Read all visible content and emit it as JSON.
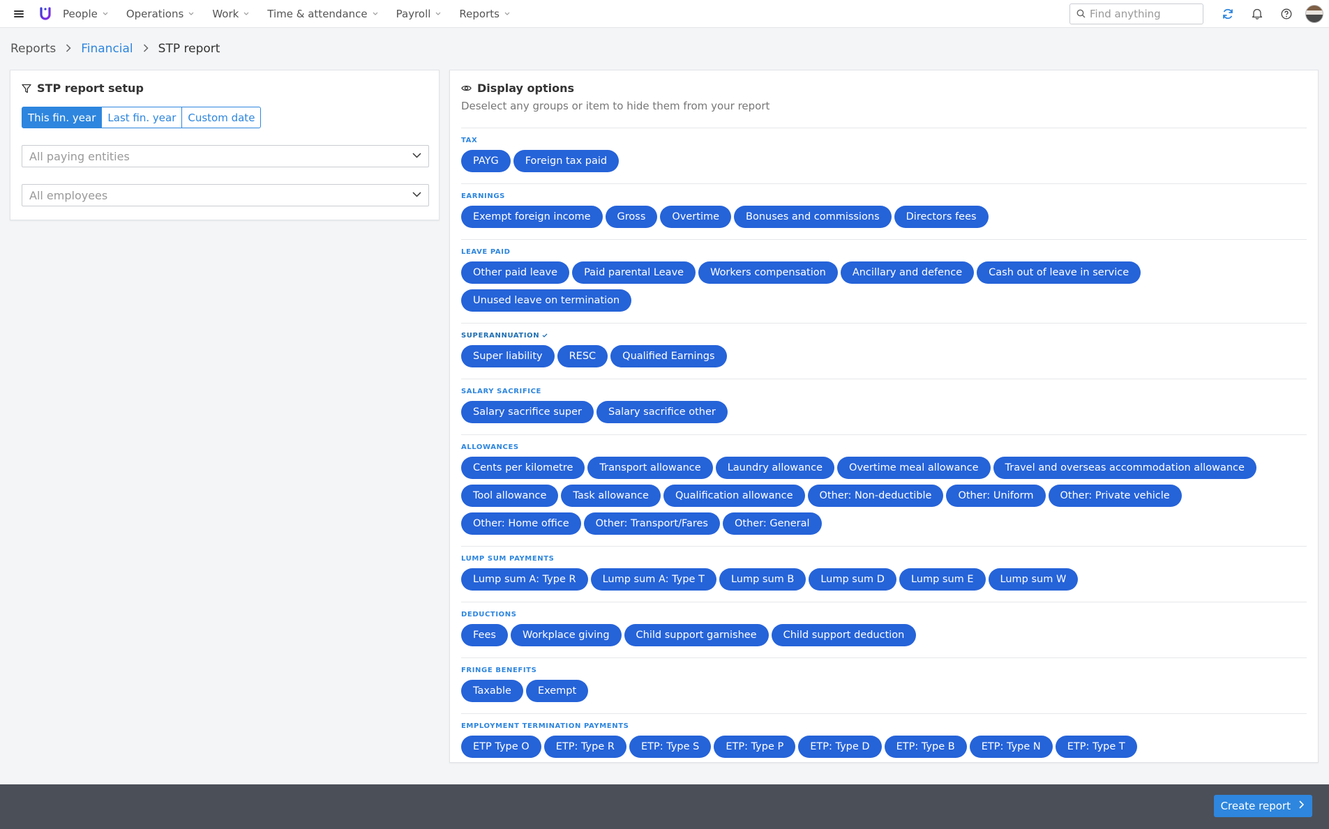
{
  "nav": {
    "items": [
      {
        "label": "People"
      },
      {
        "label": "Operations"
      },
      {
        "label": "Work"
      },
      {
        "label": "Time & attendance"
      },
      {
        "label": "Payroll"
      },
      {
        "label": "Reports"
      }
    ],
    "search_placeholder": "Find anything",
    "icons": [
      "menu-icon",
      "logo-u",
      "search-icon",
      "refresh-icon",
      "bell-icon",
      "help-icon",
      "avatar"
    ]
  },
  "breadcrumb": {
    "root": "Reports",
    "parent": "Financial",
    "current": "STP report"
  },
  "setup": {
    "title": "STP report setup",
    "periods": [
      "This fin. year",
      "Last fin. year",
      "Custom date"
    ],
    "selected_period": "This fin. year",
    "entities_placeholder": "All paying entities",
    "employees_placeholder": "All employees"
  },
  "display": {
    "title": "Display options",
    "subtitle": "Deselect any groups or item to hide them from your report",
    "groups": [
      {
        "label": "Tax",
        "items": [
          "PAYG",
          "Foreign tax paid"
        ]
      },
      {
        "label": "Earnings",
        "items": [
          "Exempt foreign income",
          "Gross",
          "Overtime",
          "Bonuses and commissions",
          "Directors fees"
        ]
      },
      {
        "label": "Leave paid",
        "items": [
          "Other paid leave",
          "Paid parental Leave",
          "Workers compensation",
          "Ancillary and defence",
          "Cash out of leave in service",
          "Unused leave on termination"
        ]
      },
      {
        "label": "Superannuation",
        "checked": true,
        "items": [
          "Super liability",
          "RESC",
          "Qualified Earnings"
        ]
      },
      {
        "label": "Salary sacrifice",
        "items": [
          "Salary sacrifice super",
          "Salary sacrifice other"
        ]
      },
      {
        "label": "Allowances",
        "items": [
          "Cents per kilometre",
          "Transport allowance",
          "Laundry allowance",
          "Overtime meal allowance",
          "Travel and overseas accommodation allowance",
          "Tool allowance",
          "Task allowance",
          "Qualification allowance",
          "Other: Non-deductible",
          "Other: Uniform",
          "Other: Private vehicle",
          "Other: Home office",
          "Other: Transport/Fares",
          "Other: General"
        ]
      },
      {
        "label": "Lump sum payments",
        "items": [
          "Lump sum A: Type R",
          "Lump sum A: Type T",
          "Lump sum B",
          "Lump sum D",
          "Lump sum E",
          "Lump sum W"
        ]
      },
      {
        "label": "Deductions",
        "items": [
          "Fees",
          "Workplace giving",
          "Child support garnishee",
          "Child support deduction"
        ]
      },
      {
        "label": "Fringe benefits",
        "items": [
          "Taxable",
          "Exempt"
        ]
      },
      {
        "label": "Employment termination payments",
        "items": [
          "ETP Type O",
          "ETP: Type R",
          "ETP: Type S",
          "ETP: Type P",
          "ETP: Type D",
          "ETP: Type B",
          "ETP: Type N",
          "ETP: Type T"
        ]
      }
    ]
  },
  "footer": {
    "create_label": "Create report"
  },
  "colors": {
    "accent": "#2e86de",
    "chip": "#2563d9",
    "footer": "#4b4f58"
  }
}
